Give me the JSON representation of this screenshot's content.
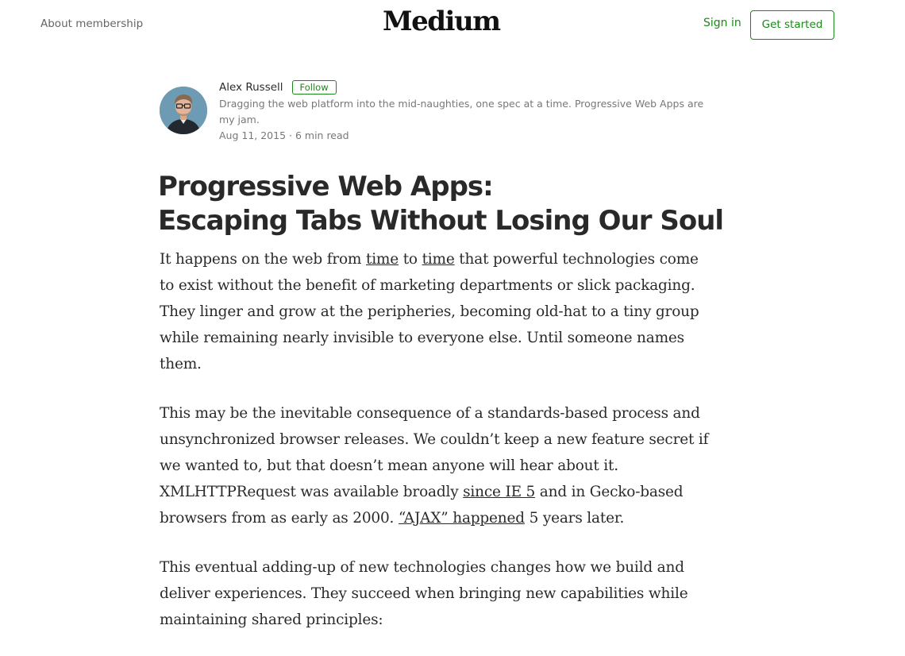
{
  "nav": {
    "about_label": "About membership",
    "logo_text": "Medium",
    "signin_label": "Sign in",
    "get_started_label": "Get started",
    "accent_color": "#1a8917"
  },
  "author": {
    "name": "Alex Russell",
    "follow_label": "Follow",
    "bio": "Dragging the web platform into the mid-naughties, one spec at a time. Progressive Web Apps are my jam.",
    "date": "Aug 11, 2015",
    "meta_separator": " · ",
    "read_time": "6 min read"
  },
  "article": {
    "title_line1": "Progressive Web Apps:",
    "title_line2": "Escaping Tabs Without Losing Our Soul",
    "p1": {
      "t1": "It happens on the web from ",
      "link1": "time",
      "t2": " to ",
      "link2": "time",
      "t3": " that powerful technologies come to exist without the benefit of marketing departments or slick packaging. They linger and grow at the peripheries, becoming old-hat to a tiny group while remaining nearly invisible to everyone else. Until someone names them."
    },
    "p2": {
      "t1": "This may be the inevitable consequence of a standards-based process and unsynchronized browser releases. We couldn’t keep a new feature secret if we wanted to, but that doesn’t mean anyone will hear about it. XMLHTTPRequest was available broadly ",
      "link1": "since IE 5",
      "t2": " and in Gecko-based browsers from as early as 2000. ",
      "link2": "“AJAX” happened",
      "t3": " 5 years later."
    },
    "p3": {
      "t1": "This eventual adding-up of new technologies changes how we build and deliver experiences. They succeed when bringing new capabilities while maintaining shared principles:"
    }
  }
}
